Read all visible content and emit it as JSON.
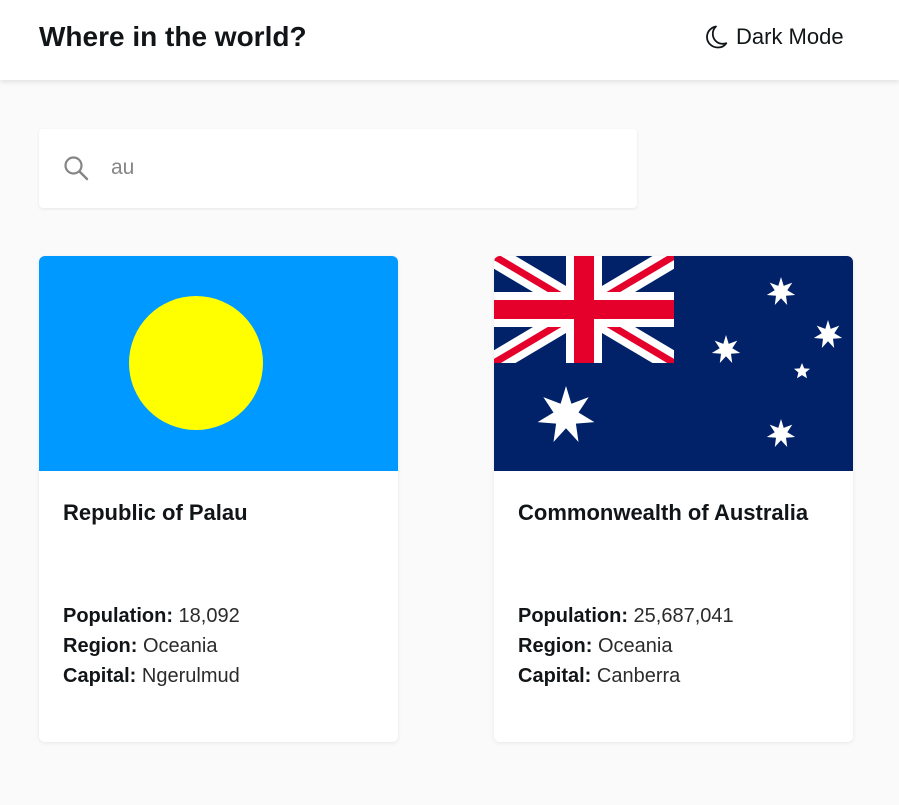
{
  "header": {
    "title": "Where in the world?",
    "theme_toggle_label": "Dark Mode",
    "theme_icon": "moon-icon"
  },
  "search": {
    "icon": "search-icon",
    "value": "au"
  },
  "countries": [
    {
      "name": "Republic of Palau",
      "population_label": "Population:",
      "population": "18,092",
      "region_label": "Region:",
      "region": "Oceania",
      "capital_label": "Capital:",
      "capital": "Ngerulmud",
      "flag": "palau-flag",
      "flag_colors": {
        "background": "#0099FF",
        "disc": "#FFFF00"
      }
    },
    {
      "name": "Commonwealth of Australia",
      "population_label": "Population:",
      "population": "25,687,041",
      "region_label": "Region:",
      "region": "Oceania",
      "capital_label": "Capital:",
      "capital": "Canberra",
      "flag": "australia-flag",
      "flag_colors": {
        "background": "#012169",
        "red": "#E4002B",
        "white": "#FFFFFF"
      }
    }
  ],
  "colors": {
    "page_background": "#FAFAFA",
    "card_background": "#FFFFFF",
    "text": "#111517"
  }
}
